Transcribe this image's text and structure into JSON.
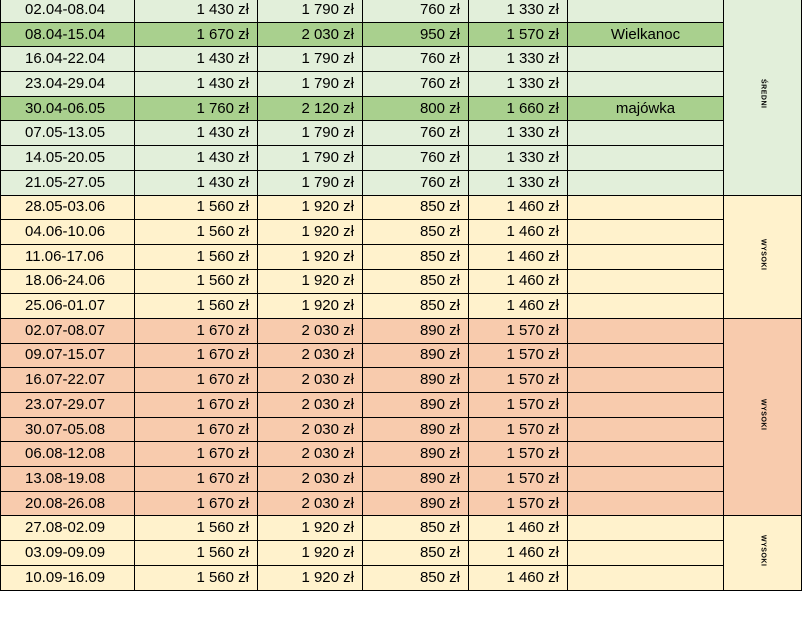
{
  "rows": [
    {
      "dates": "02.04-08.04",
      "p1": "1 430 zł",
      "p2": "1 790 zł",
      "p3": "760 zł",
      "p4": "1 330 zł",
      "note": "",
      "bg": "green"
    },
    {
      "dates": "08.04-15.04",
      "p1": "1 670 zł",
      "p2": "2 030 zł",
      "p3": "950 zł",
      "p4": "1 570 zł",
      "note": "Wielkanoc",
      "bg": "green",
      "highlight": true
    },
    {
      "dates": "16.04-22.04",
      "p1": "1 430 zł",
      "p2": "1 790 zł",
      "p3": "760 zł",
      "p4": "1 330 zł",
      "note": "",
      "bg": "green"
    },
    {
      "dates": "23.04-29.04",
      "p1": "1 430 zł",
      "p2": "1 790 zł",
      "p3": "760 zł",
      "p4": "1 330 zł",
      "note": "",
      "bg": "green"
    },
    {
      "dates": "30.04-06.05",
      "p1": "1 760 zł",
      "p2": "2 120 zł",
      "p3": "800 zł",
      "p4": "1 660 zł",
      "note": "majówka",
      "bg": "green",
      "highlight": true
    },
    {
      "dates": "07.05-13.05",
      "p1": "1 430 zł",
      "p2": "1 790 zł",
      "p3": "760 zł",
      "p4": "1 330 zł",
      "note": "",
      "bg": "green"
    },
    {
      "dates": "14.05-20.05",
      "p1": "1 430 zł",
      "p2": "1 790 zł",
      "p3": "760 zł",
      "p4": "1 330 zł",
      "note": "",
      "bg": "green"
    },
    {
      "dates": "21.05-27.05",
      "p1": "1 430 zł",
      "p2": "1 790 zł",
      "p3": "760 zł",
      "p4": "1 330 zł",
      "note": "",
      "bg": "green"
    },
    {
      "dates": "28.05-03.06",
      "p1": "1 560 zł",
      "p2": "1 920 zł",
      "p3": "850 zł",
      "p4": "1 460 zł",
      "note": "",
      "bg": "yellow"
    },
    {
      "dates": "04.06-10.06",
      "p1": "1 560 zł",
      "p2": "1 920 zł",
      "p3": "850 zł",
      "p4": "1 460 zł",
      "note": "",
      "bg": "yellow"
    },
    {
      "dates": "11.06-17.06",
      "p1": "1 560 zł",
      "p2": "1 920 zł",
      "p3": "850 zł",
      "p4": "1 460 zł",
      "note": "",
      "bg": "yellow"
    },
    {
      "dates": "18.06-24.06",
      "p1": "1 560 zł",
      "p2": "1 920 zł",
      "p3": "850 zł",
      "p4": "1 460 zł",
      "note": "",
      "bg": "yellow"
    },
    {
      "dates": "25.06-01.07",
      "p1": "1 560 zł",
      "p2": "1 920 zł",
      "p3": "850 zł",
      "p4": "1 460 zł",
      "note": "",
      "bg": "yellow"
    },
    {
      "dates": "02.07-08.07",
      "p1": "1 670 zł",
      "p2": "2 030 zł",
      "p3": "890 zł",
      "p4": "1 570 zł",
      "note": "",
      "bg": "orange"
    },
    {
      "dates": "09.07-15.07",
      "p1": "1 670 zł",
      "p2": "2 030 zł",
      "p3": "890 zł",
      "p4": "1 570 zł",
      "note": "",
      "bg": "orange"
    },
    {
      "dates": "16.07-22.07",
      "p1": "1 670 zł",
      "p2": "2 030 zł",
      "p3": "890 zł",
      "p4": "1 570 zł",
      "note": "",
      "bg": "orange"
    },
    {
      "dates": "23.07-29.07",
      "p1": "1 670 zł",
      "p2": "2 030 zł",
      "p3": "890 zł",
      "p4": "1 570 zł",
      "note": "",
      "bg": "orange"
    },
    {
      "dates": "30.07-05.08",
      "p1": "1 670 zł",
      "p2": "2 030 zł",
      "p3": "890 zł",
      "p4": "1 570 zł",
      "note": "",
      "bg": "orange"
    },
    {
      "dates": "06.08-12.08",
      "p1": "1 670 zł",
      "p2": "2 030 zł",
      "p3": "890 zł",
      "p4": "1 570 zł",
      "note": "",
      "bg": "orange"
    },
    {
      "dates": "13.08-19.08",
      "p1": "1 670 zł",
      "p2": "2 030 zł",
      "p3": "890 zł",
      "p4": "1 570 zł",
      "note": "",
      "bg": "orange"
    },
    {
      "dates": "20.08-26.08",
      "p1": "1 670 zł",
      "p2": "2 030 zł",
      "p3": "890 zł",
      "p4": "1 570 zł",
      "note": "",
      "bg": "orange"
    },
    {
      "dates": "27.08-02.09",
      "p1": "1 560 zł",
      "p2": "1 920 zł",
      "p3": "850 zł",
      "p4": "1 460 zł",
      "note": "",
      "bg": "yellow"
    },
    {
      "dates": "03.09-09.09",
      "p1": "1 560 zł",
      "p2": "1 920 zł",
      "p3": "850 zł",
      "p4": "1 460 zł",
      "note": "",
      "bg": "yellow"
    },
    {
      "dates": "10.09-16.09",
      "p1": "1 560 zł",
      "p2": "1 920 zł",
      "p3": "850 zł",
      "p4": "1 460 zł",
      "note": "",
      "bg": "yellow"
    }
  ],
  "seasons": [
    {
      "label": "ŚREDNI",
      "span": 8,
      "bg": "green"
    },
    {
      "label": "WYSOKI",
      "span": 5,
      "bg": "yellow"
    },
    {
      "label": "WYSOKI",
      "span": 8,
      "bg": "orange"
    },
    {
      "label": "WYSOKI",
      "span": 3,
      "bg": "yellow"
    }
  ],
  "colors": {
    "green": "#e2efda",
    "green_highlight": "#a9d08e",
    "yellow": "#fff2cc",
    "orange": "#f8cbad",
    "border": "#000000"
  }
}
